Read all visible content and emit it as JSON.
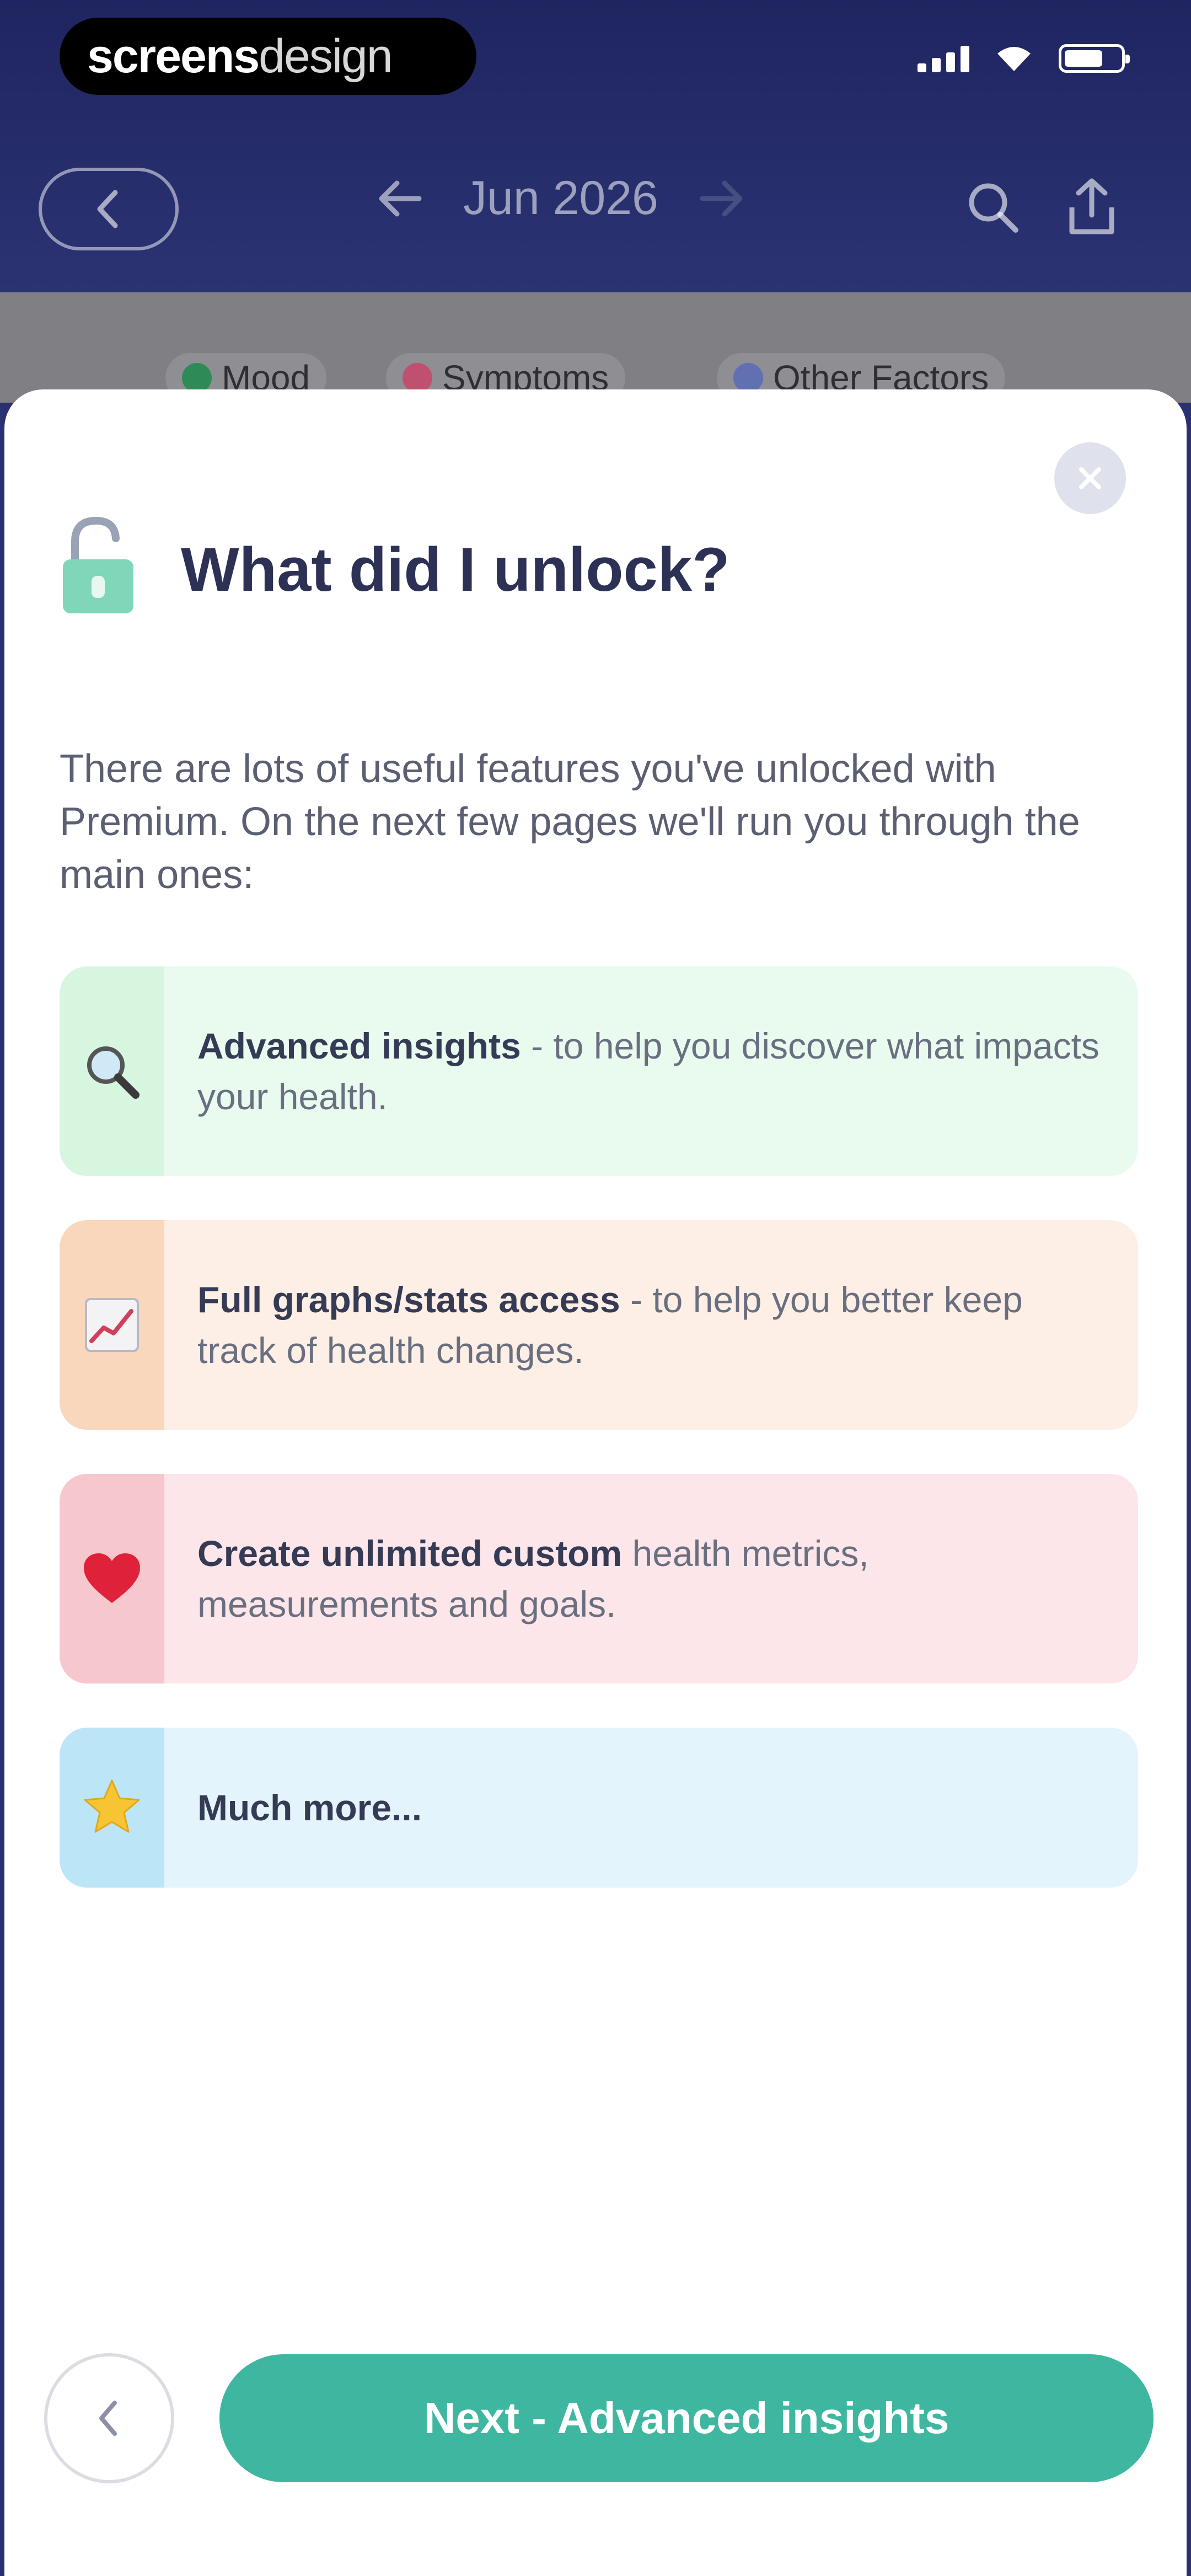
{
  "brand": {
    "part1": "screens",
    "part2": "design"
  },
  "header": {
    "month_label": "Jun 2026"
  },
  "filters": [
    {
      "label": "Mood",
      "color": "#2e8b57"
    },
    {
      "label": "Symptoms",
      "color": "#c05070"
    },
    {
      "label": "Other Factors",
      "color": "#6070b0"
    }
  ],
  "modal": {
    "title": "What did I unlock?",
    "intro": "There are lots of useful features you've unlocked with Premium. On the next few pages we'll run you through the main ones:",
    "features": [
      {
        "icon": "magnifier-icon",
        "bold": "Advanced insights",
        "rest": " - to help you discover what impacts your health."
      },
      {
        "icon": "chart-icon",
        "bold": "Full graphs/stats access",
        "rest": " - to help you better keep track of health changes."
      },
      {
        "icon": "heart-icon",
        "bold": "Create unlimited custom",
        "rest": " health metrics, measurements and goals."
      },
      {
        "icon": "star-icon",
        "bold": "Much more...",
        "rest": ""
      }
    ],
    "next_label": "Next - Advanced insights"
  },
  "colors": {
    "header_bg": "#2b3373",
    "accent": "#3fb7a0",
    "title": "#2d3155"
  }
}
